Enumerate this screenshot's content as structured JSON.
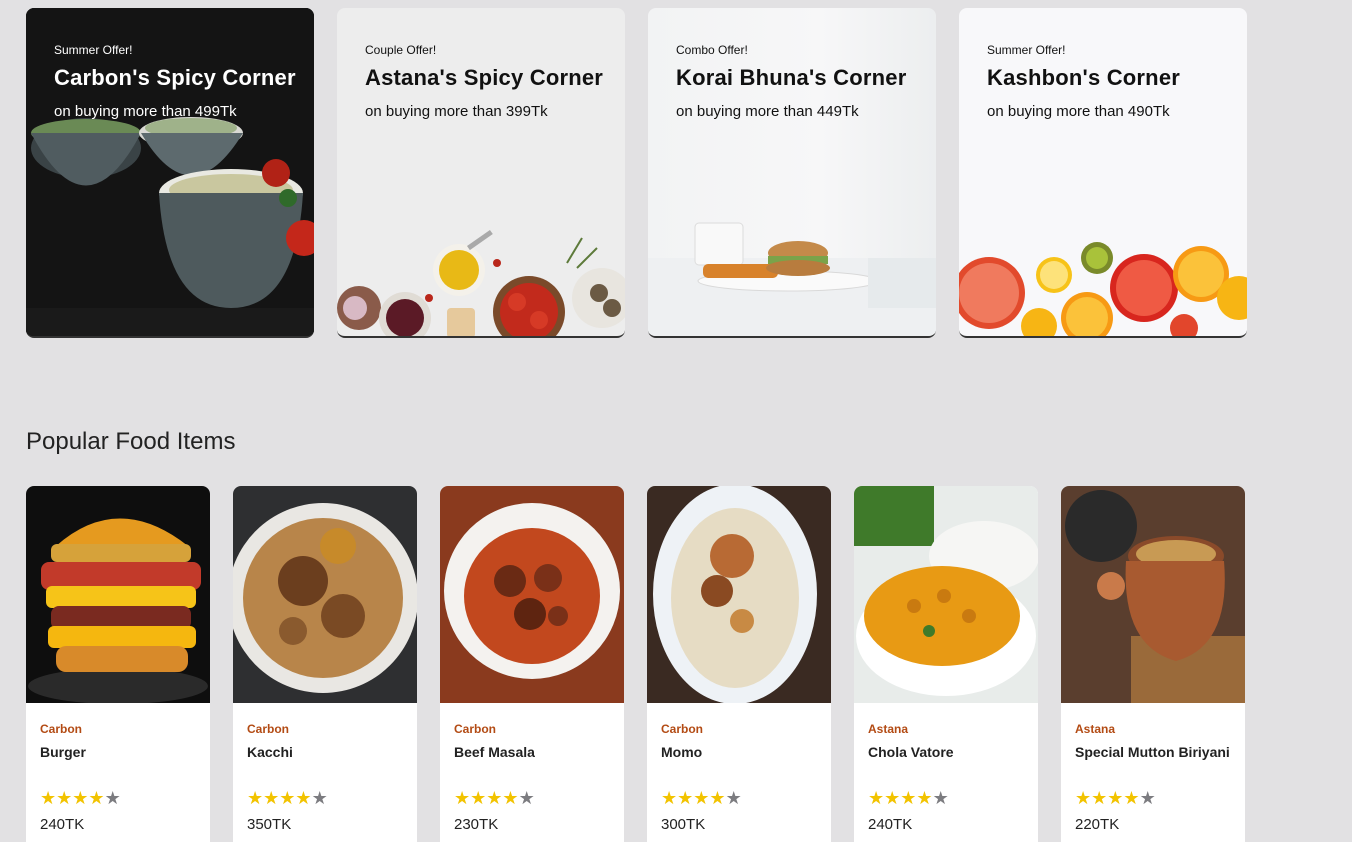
{
  "offers": [
    {
      "tag": "Summer Offer!",
      "title": "Carbon's Spicy Corner",
      "subtitle": "on buying more than 499Tk"
    },
    {
      "tag": "Couple Offer!",
      "title": "Astana's Spicy Corner",
      "subtitle": "on buying more than 399Tk"
    },
    {
      "tag": "Combo Offer!",
      "title": "Korai Bhuna's Corner",
      "subtitle": "on buying more than 449Tk"
    },
    {
      "tag": "Summer Offer!",
      "title": "Kashbon's Corner",
      "subtitle": "on buying more than 490Tk"
    }
  ],
  "popular": {
    "title": "Popular Food Items",
    "items": [
      {
        "shop": "Carbon",
        "name": "Burger",
        "rating": 4,
        "max_rating": 5,
        "price": "240TK"
      },
      {
        "shop": "Carbon",
        "name": "Kacchi",
        "rating": 4,
        "max_rating": 5,
        "price": "350TK"
      },
      {
        "shop": "Carbon",
        "name": "Beef Masala",
        "rating": 4,
        "max_rating": 5,
        "price": "230TK"
      },
      {
        "shop": "Carbon",
        "name": "Momo",
        "rating": 4,
        "max_rating": 5,
        "price": "300TK"
      },
      {
        "shop": "Astana",
        "name": "Chola Vatore",
        "rating": 4,
        "max_rating": 5,
        "price": "240TK"
      },
      {
        "shop": "Astana",
        "name": "Special Mutton Biriyani",
        "rating": 4,
        "max_rating": 5,
        "price": "220TK"
      }
    ]
  },
  "colors": {
    "shop_label": "#b34b14",
    "star_filled": "#f2c300",
    "star_empty": "#7c7c80",
    "page_bg": "#e2e1e3"
  }
}
